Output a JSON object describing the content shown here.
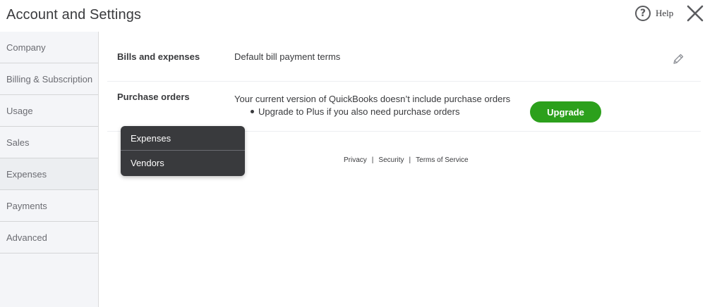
{
  "header": {
    "title": "Account and Settings",
    "help_label": "Help",
    "help_glyph": "?"
  },
  "sidebar": {
    "items": [
      {
        "label": "Company"
      },
      {
        "label": "Billing & Subscription"
      },
      {
        "label": "Usage"
      },
      {
        "label": "Sales"
      },
      {
        "label": "Expenses",
        "active": true
      },
      {
        "label": "Payments"
      },
      {
        "label": "Advanced"
      }
    ]
  },
  "main": {
    "bills": {
      "label": "Bills and expenses",
      "value": "Default bill payment terms"
    },
    "purchase_orders": {
      "label": "Purchase orders",
      "message": "Your current version of QuickBooks doesn’t include purchase orders",
      "bullet": "Upgrade to Plus if you also need purchase orders",
      "upgrade_label": "Upgrade"
    }
  },
  "dropdown": {
    "items": [
      {
        "label": "Expenses"
      },
      {
        "label": "Vendors"
      }
    ]
  },
  "footer": {
    "privacy": "Privacy",
    "security": "Security",
    "terms": "Terms of Service",
    "separator": "|"
  },
  "colors": {
    "accent": "#2ca01c",
    "text": "#393a3d",
    "sidebar_bg": "#f4f5f8",
    "menu_bg": "#393a3d"
  },
  "icons": [
    "help-icon",
    "close-icon",
    "pencil-icon"
  ]
}
